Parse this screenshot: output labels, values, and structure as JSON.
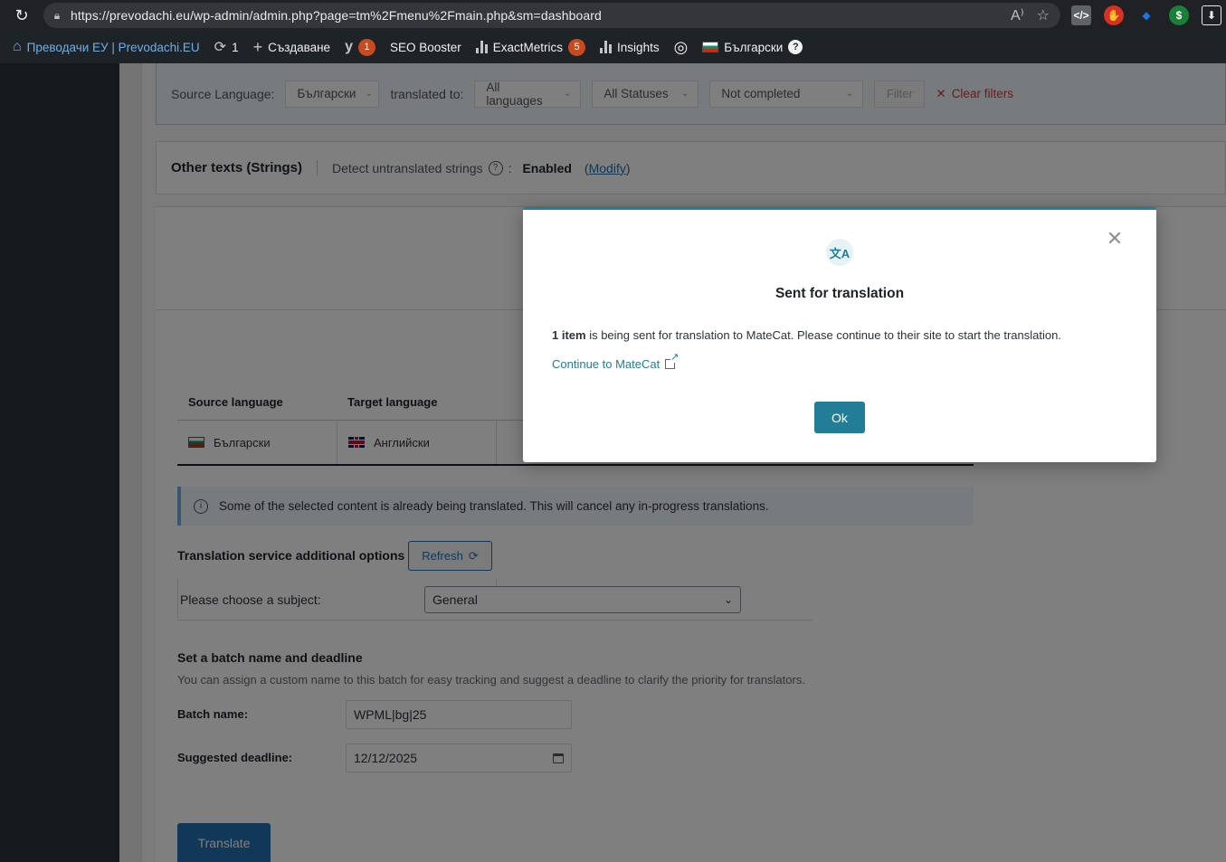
{
  "browser": {
    "url": "https://prevodachi.eu/wp-admin/admin.php?page=tm%2Fmenu%2Fmain.php&sm=dashboard"
  },
  "adminbar": {
    "site_name": "Преводачи ЕУ | Prevodachi.EU",
    "updates_count": "1",
    "new_label": "Създаване",
    "yoast_count": "1",
    "seo_booster": "SEO Booster",
    "exactmetrics": "ExactMetrics",
    "exactmetrics_count": "5",
    "insights": "Insights",
    "language": "Български",
    "help": "?"
  },
  "filters": {
    "source_label": "Source Language:",
    "source_value": "Български",
    "translated_to_label": "translated to:",
    "languages_value": "All languages",
    "statuses_value": "All Statuses",
    "completion_value": "Not completed",
    "filter_btn": "Filter",
    "clear_filters": "Clear filters"
  },
  "strings": {
    "title": "Other texts (Strings)",
    "detect_label": "Detect untranslated strings",
    "colon": ":",
    "enabled": "Enabled",
    "modify": "Modify"
  },
  "table": {
    "headers": [
      "Source language",
      "Target language"
    ],
    "row": {
      "source": "Български",
      "target": "Английски"
    }
  },
  "notice": {
    "text": "Some of the selected content is already being translated. This will cancel any in-progress translations."
  },
  "options": {
    "title": "Translation service additional options",
    "refresh": "Refresh",
    "subject_label": "Please choose a subject:",
    "subject_value": "General"
  },
  "batch": {
    "title": "Set a batch name and deadline",
    "desc": "You can assign a custom name to this batch for easy tracking and suggest a deadline to clarify the priority for translators.",
    "name_label": "Batch name:",
    "name_value": "WPML|bg|25",
    "deadline_label": "Suggested deadline:",
    "deadline_value": "12/12/2025",
    "translate_btn": "Translate"
  },
  "modal": {
    "title": "Sent for translation",
    "count_text": "1 item",
    "text_rest": " is being sent for translation to MateCat. Please continue to their site to start the translation.",
    "link": "Continue to MateCat",
    "ok": "Ok",
    "icon_glyph": "文A"
  },
  "colors": {
    "wp_blue": "#2271b1",
    "wpml_teal": "#227e96",
    "adminbar_bg": "#1d2327"
  }
}
